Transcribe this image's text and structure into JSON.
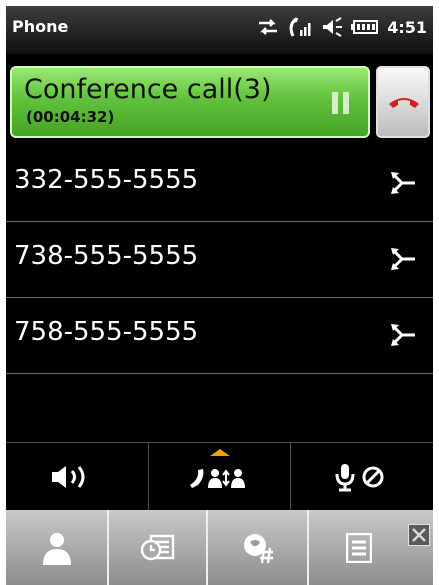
{
  "status_bar": {
    "app_title": "Phone",
    "time": "4:51",
    "icons": [
      "data-sync-icon",
      "signal-icon",
      "volume-icon",
      "battery-icon"
    ]
  },
  "call": {
    "title": "Conference call(3)",
    "timer": "(00:04:32)",
    "pause_icon": "pause-icon",
    "end_call_icon": "end-call-icon"
  },
  "participants": [
    {
      "number": "332-555-5555",
      "action_icon": "split-call-icon"
    },
    {
      "number": "738-555-5555",
      "action_icon": "split-call-icon"
    },
    {
      "number": "758-555-5555",
      "action_icon": "split-call-icon"
    }
  ],
  "controls": [
    "speaker-icon",
    "merge-calls-icon",
    "mute-icon"
  ],
  "app_bar": [
    "contacts-icon",
    "call-history-icon",
    "keypad-icon",
    "menu-icon",
    "close-icon"
  ],
  "colors": {
    "call_green": "#5fc23a",
    "end_call_red": "#d42020",
    "accent_orange": "#f5a000",
    "background": "#000000"
  }
}
